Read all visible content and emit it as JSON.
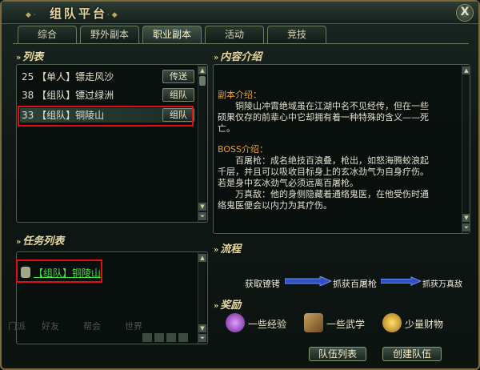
{
  "window": {
    "title": "组队平台",
    "close_label": "X"
  },
  "tabs": [
    {
      "label": "综合",
      "active": false
    },
    {
      "label": "野外副本",
      "active": false
    },
    {
      "label": "职业副本",
      "active": true
    },
    {
      "label": "活动",
      "active": false
    },
    {
      "label": "竞技",
      "active": false
    }
  ],
  "list": {
    "heading": "列表",
    "rows": [
      {
        "num": "25",
        "name": "【单人】镖走风沙",
        "action": "传送"
      },
      {
        "num": "38",
        "name": "【组队】镖过绿洲",
        "action": "组队"
      },
      {
        "num": "33",
        "name": "【组队】铜陵山",
        "action": "组队",
        "selected": true
      }
    ]
  },
  "tasks": {
    "heading": "任务列表",
    "items": [
      {
        "label": "【组队】铜陵山"
      }
    ]
  },
  "content": {
    "heading": "内容介绍",
    "dungeon_title": "副本介绍：",
    "dungeon_text": [
      "铜陵山冲霄绝域虽在江湖中名不见经传，但在一些",
      "硕果仅存的前辈心中它却拥有着一种特殊的含义——死",
      "亡。"
    ],
    "boss_title": "BOSS介绍：",
    "boss_text": [
      "百屠枪：成名绝技百浪叠，枪出，如怒海腾蛟浪起",
      "千层，并且可以吸收目标身上的玄冰劲气为自身疗伤。",
      "若是身中玄冰劲气必须远离百屠枪。",
      "万真敌：他的身侧隐藏着通络鬼医，在他受伤时通",
      "络鬼医便会以内力为其疗伤。"
    ]
  },
  "flow": {
    "heading": "流程",
    "steps": [
      "获取镣铐",
      "抓获百屠枪",
      "抓获万真敌"
    ]
  },
  "rewards": {
    "heading": "奖励",
    "items": [
      {
        "label": "一些经验",
        "icon": "exp-orb-icon",
        "color": "#9a40c0"
      },
      {
        "label": "一些武学",
        "icon": "scroll-icon",
        "color": "#8a6a3a"
      },
      {
        "label": "少量财物",
        "icon": "coins-icon",
        "color": "#d0a020"
      }
    ]
  },
  "footer": {
    "team_list": "队伍列表",
    "create_team": "创建队伍",
    "bg_words": [
      "门派",
      "好友",
      "帮会",
      "世界"
    ]
  }
}
